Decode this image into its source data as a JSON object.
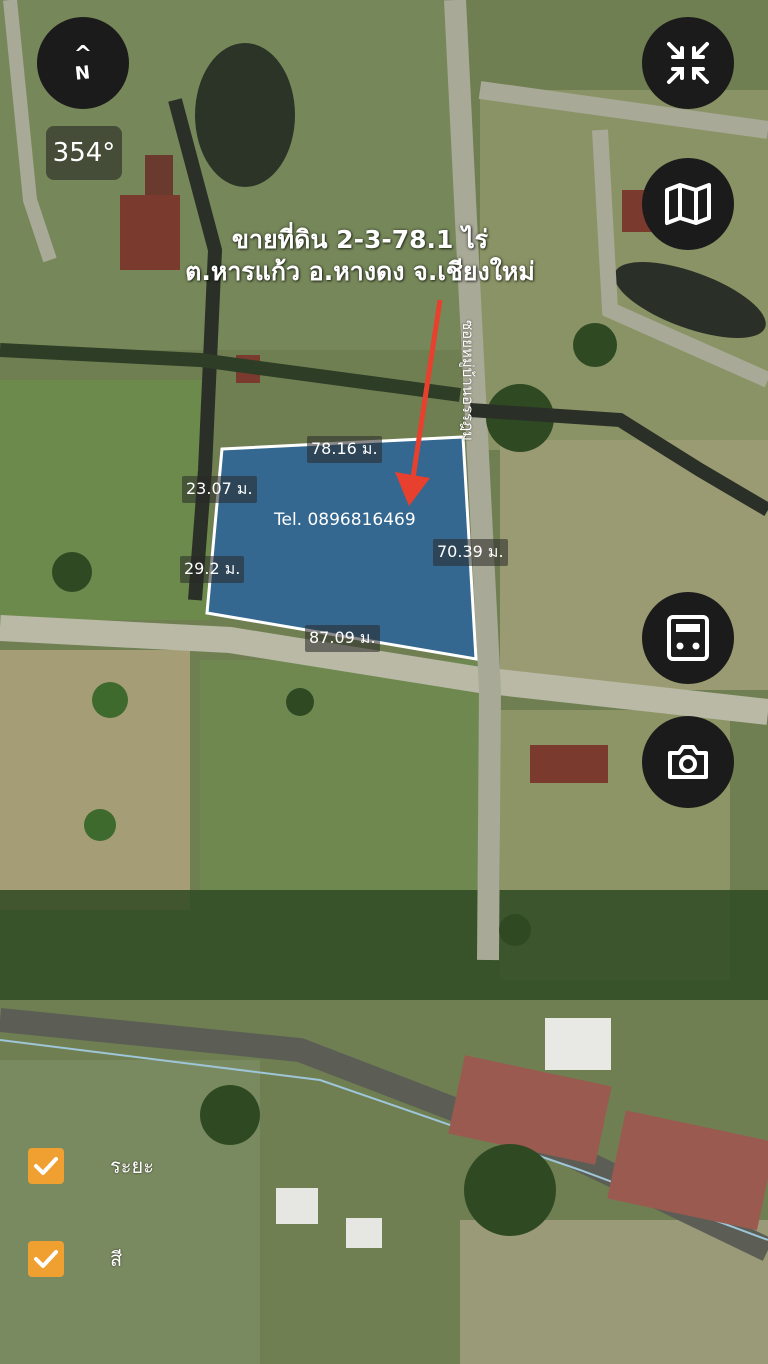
{
  "compass": {
    "caret": "^",
    "letter": "N"
  },
  "heading": "354°",
  "title_line1": "ขายที่ดิน 2-3-78.1 ไร่",
  "title_line2": "ต.หารแก้ว อ.หางดง จ.เชียงใหม่",
  "phone": "Tel. 0896816469",
  "road_name": "ซอยหมู่บ้านอรรฎม",
  "dimensions": {
    "top": "78.16 ม.",
    "left_upper": "23.07 ม.",
    "left_lower": "29.2 ม.",
    "right": "70.39 ม.",
    "bottom": "87.09 ม."
  },
  "toggles": [
    {
      "label": "ระยะ",
      "checked": true
    },
    {
      "label": "สี",
      "checked": true
    }
  ],
  "buttons": {
    "collapse": "collapse-icon",
    "map_layers": "map-icon",
    "calculator": "calculator-icon",
    "camera": "camera-icon"
  },
  "colors": {
    "parcel_fill": "#1d5fa8",
    "arrow": "#e8402e",
    "checkbox": "#f0a030"
  }
}
